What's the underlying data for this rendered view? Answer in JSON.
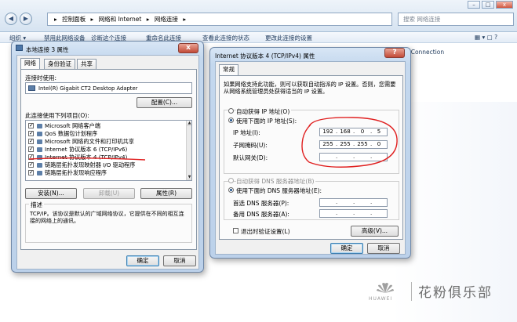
{
  "explorer": {
    "breadcrumb": [
      "▸",
      "控制面板",
      "▸",
      "网络和 Internet",
      "▸",
      "网络连接",
      "▸"
    ],
    "search_placeholder": "搜索 网络连接",
    "commands": [
      "组织 ▾",
      "禁用此网络设备",
      "诊断这个连接",
      "重命名此连接",
      "查看此连接的状态",
      "更改此连接的设置"
    ],
    "right_line": "al Area Connection"
  },
  "dlg1": {
    "title": "本地连接 3 属性",
    "tabs": [
      "网络",
      "身份验证",
      "共享"
    ],
    "connect_using_label": "连接时使用:",
    "adapter_name": "Intel(R) Gigabit CT2 Desktop Adapter",
    "configure_btn": "配置(C)...",
    "items_label": "此连接使用下列项目(O):",
    "items": [
      "Microsoft 网络客户端",
      "QoS 数据包计划程序",
      "Microsoft 网络的文件和打印机共享",
      "Internet 协议版本 6 (TCP/IPv6)",
      "Internet 协议版本 4 (TCP/IPv4)",
      "链路层拓扑发现映射器 I/O 驱动程序",
      "链路层拓扑发现响应程序"
    ],
    "install_btn": "安装(N)...",
    "uninstall_btn": "卸载(U)",
    "properties_btn": "属性(R)",
    "desc_label": "描述",
    "desc_text": "TCP/IP。该协议是默认的广域网络协议，它提供在不同的相互连接的网络上的通讯。",
    "ok_btn": "确定",
    "cancel_btn": "取消"
  },
  "dlg2": {
    "title": "Internet 协议版本 4 (TCP/IPv4) 属性",
    "tab": "常规",
    "intro": "如果网络支持此功能，则可以获取自动指派的 IP 设置。否则，您需要从网络系统管理员处获得适当的 IP 设置。",
    "auto_ip": "自动获得 IP 地址(O)",
    "use_ip": "使用下面的 IP 地址(S):",
    "ip_label": "IP 地址(I):",
    "ip_value": [
      "192",
      "168",
      "0",
      "5"
    ],
    "mask_label": "子网掩码(U):",
    "mask_value": [
      "255",
      "255",
      "255",
      "0"
    ],
    "gw_label": "默认网关(D):",
    "auto_dns": "自动获得 DNS 服务器地址(B)",
    "use_dns": "使用下面的 DNS 服务器地址(E):",
    "dns1_label": "首选 DNS 服务器(P):",
    "dns2_label": "备用 DNS 服务器(A):",
    "validate": "退出时验证设置(L)",
    "advanced_btn": "高级(V)...",
    "ok_btn": "确定",
    "cancel_btn": "取消"
  },
  "watermark": {
    "brand": "HUAWEI",
    "text": "花粉俱乐部"
  },
  "colors": {
    "annotation_red": "#e02020",
    "title_blue": "#1e395b"
  }
}
